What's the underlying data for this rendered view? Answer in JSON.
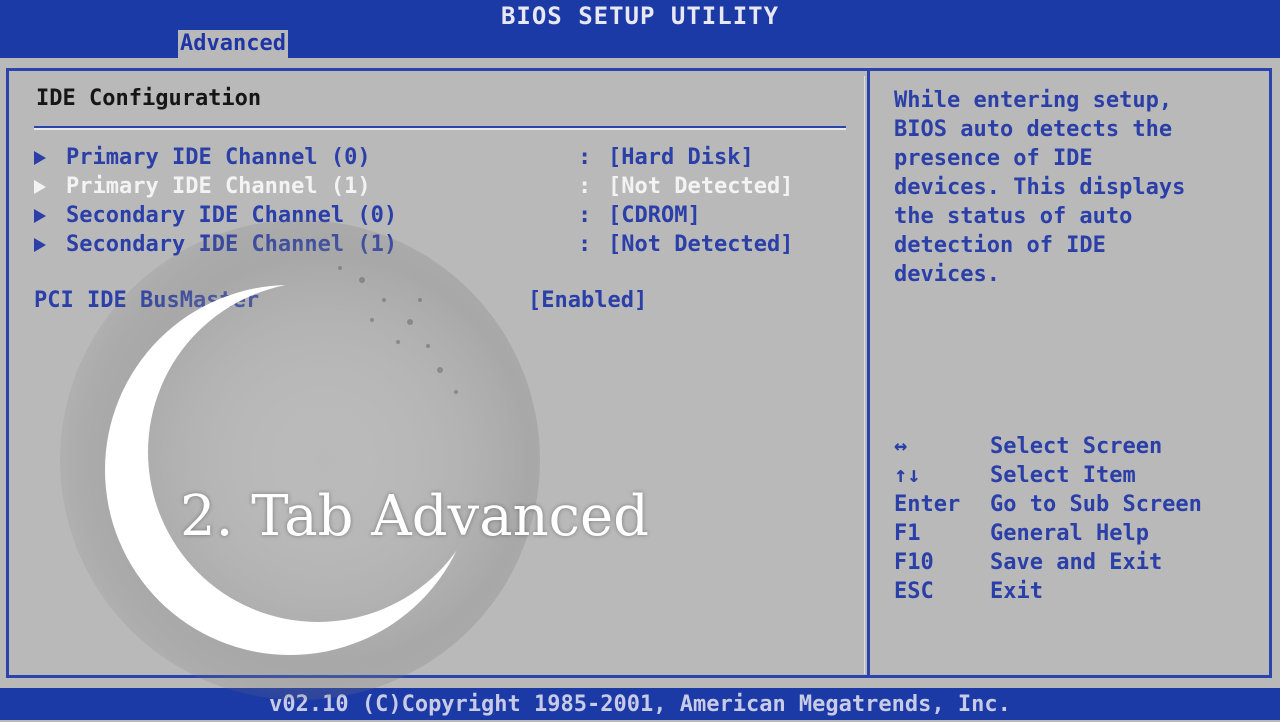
{
  "header": {
    "title": "BIOS SETUP UTILITY",
    "active_tab": "Advanced"
  },
  "main": {
    "section_title": "IDE Configuration",
    "items": [
      {
        "label": "Primary IDE Channel (0)",
        "colon": ":",
        "value": "[Hard Disk]"
      },
      {
        "label": "Primary IDE Channel (1)",
        "colon": ":",
        "value": "[Not Detected]",
        "selected": true
      },
      {
        "label": "Secondary IDE Channel (0)",
        "colon": ":",
        "value": "[CDROM]"
      },
      {
        "label": "Secondary IDE Channel (1)",
        "colon": ":",
        "value": "[Not Detected]"
      }
    ],
    "busmaster": {
      "label": "PCI IDE BusMaster",
      "value": "[Enabled]"
    }
  },
  "help": {
    "lines": [
      "While entering setup,",
      "BIOS auto detects the",
      "presence of IDE",
      "devices. This displays",
      "the status of auto",
      "detection of IDE",
      "devices."
    ],
    "keys": [
      {
        "key": "↔",
        "desc": "Select Screen"
      },
      {
        "key": "↑↓",
        "desc": "Select Item"
      },
      {
        "key": "Enter",
        "desc": "Go to Sub Screen"
      },
      {
        "key": "F1",
        "desc": "General Help"
      },
      {
        "key": "F10",
        "desc": "Save and Exit"
      },
      {
        "key": "ESC",
        "desc": "Exit"
      }
    ]
  },
  "footer": {
    "text": "v02.10 (C)Copyright 1985-2001, American Megatrends, Inc."
  },
  "overlay": {
    "caption": "2. Tab Advanced"
  },
  "colors": {
    "bios_blue": "#1c3aa6",
    "panel_gray": "#b9b9b9",
    "text_blue": "#2b3fa8"
  }
}
